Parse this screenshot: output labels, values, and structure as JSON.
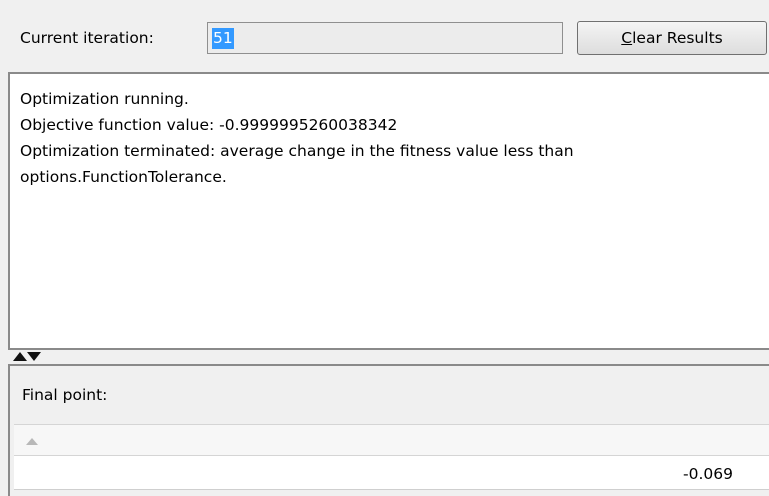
{
  "iteration": {
    "label": "Current iteration:",
    "value": "51"
  },
  "toolbar": {
    "clear_label_mnemonic": "C",
    "clear_label_rest": "lear Results"
  },
  "results": {
    "lines": [
      "Optimization running.",
      "Objective function value: -0.9999995260038342",
      "Optimization terminated: average change in the fitness value less than",
      "options.FunctionTolerance."
    ]
  },
  "splitter": {
    "icons": [
      "triangle-up-icon",
      "triangle-down-icon"
    ]
  },
  "final_point": {
    "label": "Final point:",
    "sort_icon": "sort-ascending-icon",
    "values": [
      "-0.069"
    ]
  },
  "colors": {
    "selection_highlight": "#3399ff",
    "window_background": "#f0f0f0",
    "text_area_background": "#ffffff"
  }
}
